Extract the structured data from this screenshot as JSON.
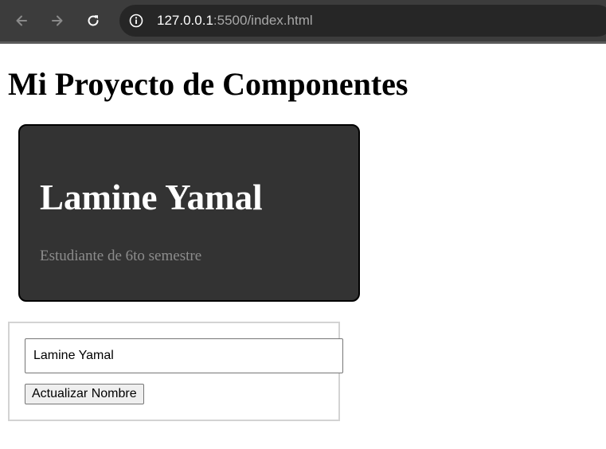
{
  "browser": {
    "url_host": "127.0.0.1",
    "url_rest": ":5500/index.html",
    "back_icon": "arrow-left-icon",
    "forward_icon": "arrow-right-icon",
    "reload_icon": "reload-icon",
    "site_info_icon": "info-icon",
    "colors": {
      "toolbar_bg": "#3c3c3c",
      "omnibox_bg": "#262626",
      "url_host": "#ffffff",
      "url_rest": "#a8a8a8"
    }
  },
  "page": {
    "title": "Mi Proyecto de Componentes"
  },
  "profile_card": {
    "name": "Lamine Yamal",
    "role": "Estudiante de 6to semestre",
    "colors": {
      "background": "#333333",
      "name": "#ffffff",
      "role": "#8c8c8c"
    }
  },
  "form": {
    "name_input_value": "Lamine Yamal",
    "update_button_label": "Actualizar Nombre"
  }
}
